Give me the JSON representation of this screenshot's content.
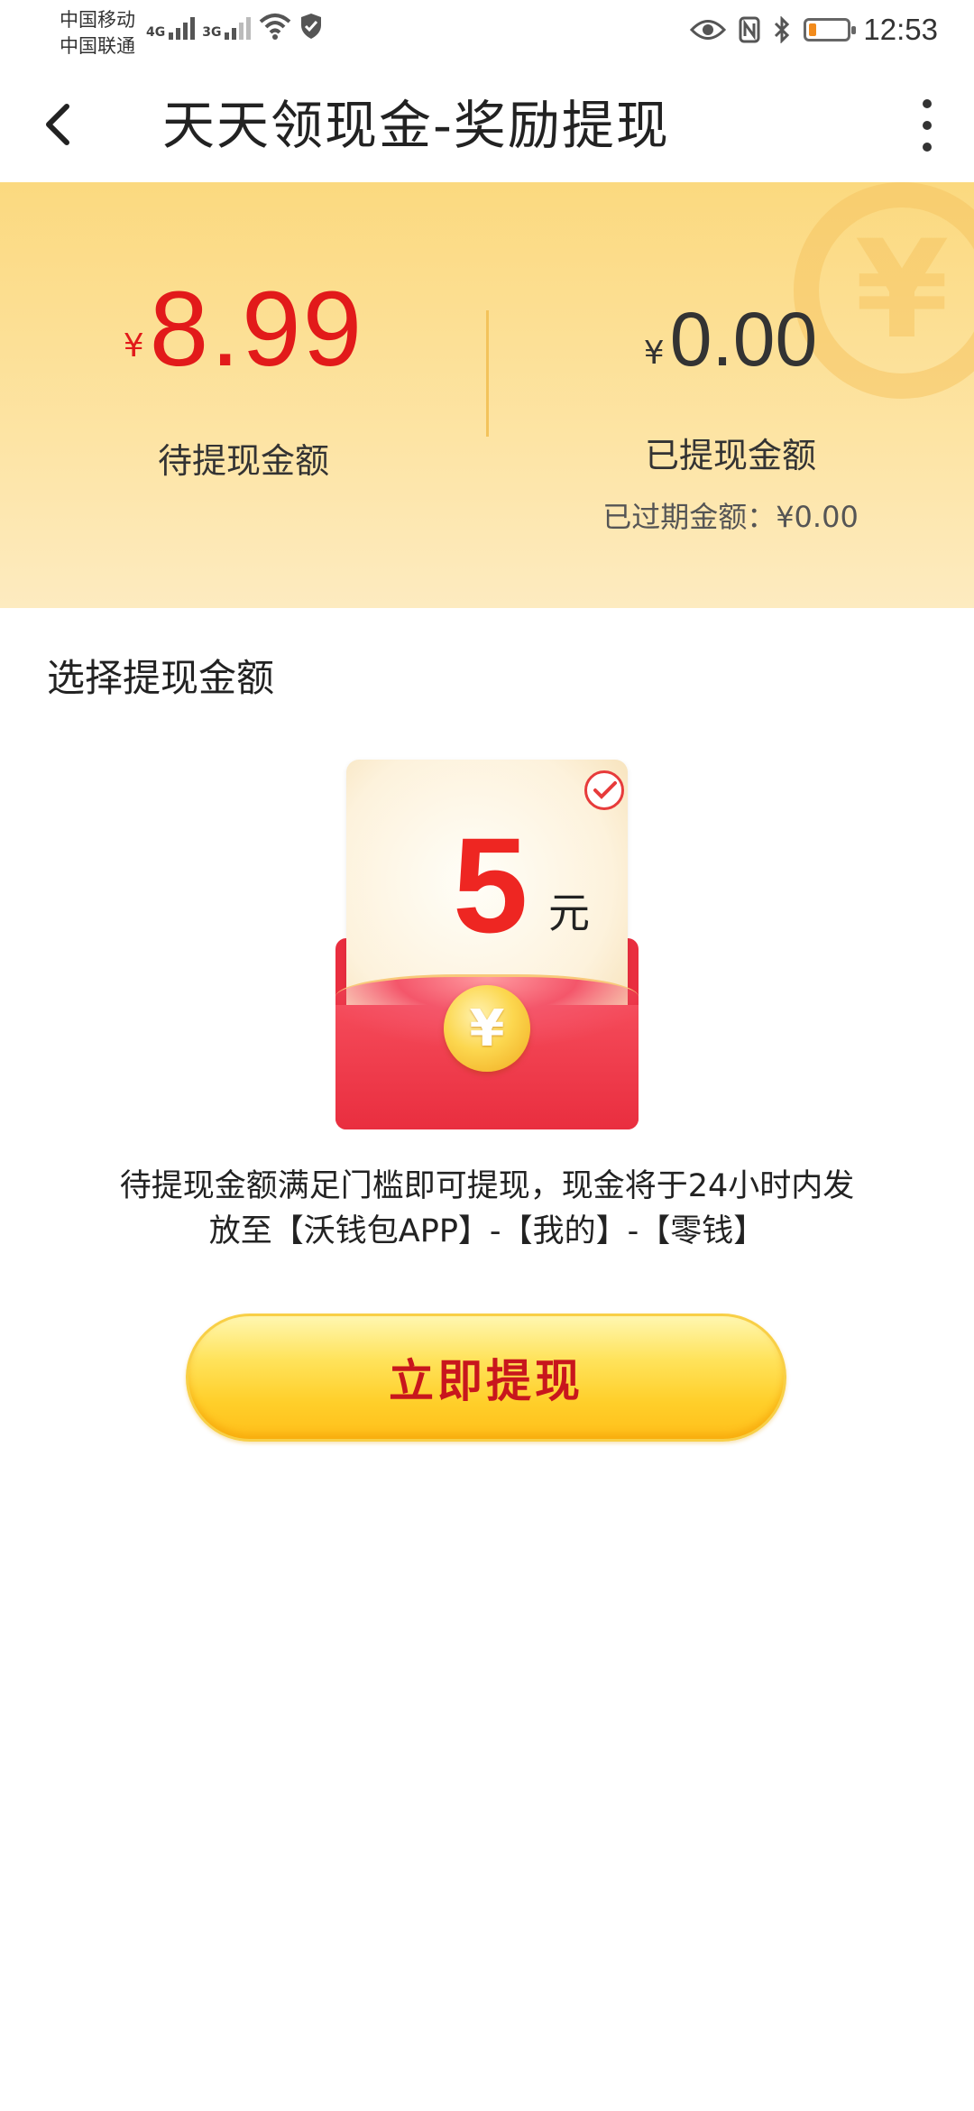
{
  "status_bar": {
    "carrier_1": "中国移动",
    "carrier_2": "中国联通",
    "net_1": "4G",
    "net_2": "3G",
    "time": "12:53",
    "battery_level": 0.2
  },
  "nav": {
    "title": "天天领现金-奖励提现"
  },
  "balance": {
    "currency_symbol": "¥",
    "pending_amount": "8.99",
    "pending_label": "待提现金额",
    "withdrawn_amount": "0.00",
    "withdrawn_label": "已提现金额",
    "expired_text": "已过期金额：¥0.00"
  },
  "select": {
    "title": "选择提现金额",
    "option_value": "5",
    "option_unit": "元",
    "option_selected": true,
    "coin_symbol": "¥"
  },
  "notice": {
    "line1": "待提现金额满足门槛即可提现，现金将于24小时内发",
    "line2": "放至【沃钱包APP】-【我的】-【零钱】"
  },
  "cta": {
    "label": "立即提现"
  },
  "colors": {
    "accent_red": "#e21a1a",
    "gold": "#fbd97f",
    "button_yellow": "#ffcf2a"
  }
}
